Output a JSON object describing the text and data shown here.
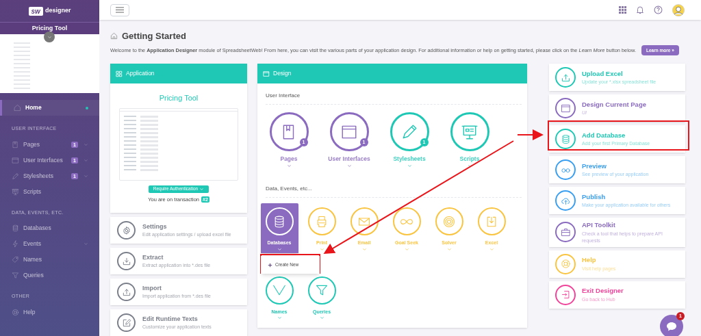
{
  "sidebar": {
    "logo_mark": "sw",
    "logo_text": "designer",
    "app_name": "Pricing Tool",
    "nav": [
      {
        "items": [
          {
            "label": "Home",
            "selected": true,
            "caret": false
          }
        ]
      },
      {
        "heading": "USER INTERFACE",
        "items": [
          {
            "label": "Pages",
            "badge": "1",
            "selected": false,
            "caret": true
          },
          {
            "label": "User Interfaces",
            "badge": "1",
            "selected": false,
            "caret": true
          },
          {
            "label": "Stylesheets",
            "badge": "1",
            "selected": false,
            "caret": true
          },
          {
            "label": "Scripts",
            "selected": false,
            "caret": false
          }
        ]
      },
      {
        "heading": "DATA, EVENTS, ETC.",
        "items": [
          {
            "label": "Databases",
            "selected": false,
            "caret": false
          },
          {
            "label": "Events",
            "selected": false,
            "caret": true
          },
          {
            "label": "Names",
            "selected": false,
            "caret": false
          },
          {
            "label": "Queries",
            "selected": false,
            "caret": false
          }
        ]
      },
      {
        "heading": "OTHER",
        "items": [
          {
            "label": "Help",
            "selected": false,
            "caret": false
          }
        ]
      }
    ]
  },
  "header": {
    "title": "Getting Started",
    "intro": "Welcome to the **Application Designer** module of SpreadsheetWeb! From here, you can visit the various parts of your application design. For additional information or help on getting started, please click on the *Learn More* button below.",
    "learn_more": "Learn more »"
  },
  "application": {
    "heading": "Application",
    "app_name": "Pricing Tool",
    "auth_button": "Require Authentication",
    "transaction_text": "You are on transaction",
    "transaction": "#2",
    "actions": [
      {
        "title": "Settings",
        "subtitle": "Edit application settings / upload excel file"
      },
      {
        "title": "Extract",
        "subtitle": "Extract application into *.des file"
      },
      {
        "title": "Import",
        "subtitle": "Import application from *.des file"
      },
      {
        "title": "Edit Runtime Texts",
        "subtitle": "Customize your application texts"
      }
    ]
  },
  "design": {
    "heading": "Design",
    "ui_heading": "User Interface",
    "ui_items": [
      {
        "label": "Pages",
        "badge": "1",
        "color": "#8a6bbf"
      },
      {
        "label": "User Interfaces",
        "badge": "1",
        "color": "#8a6bbf"
      },
      {
        "label": "Stylesheets",
        "badge": "1",
        "color": "#1fc8b5"
      },
      {
        "label": "Scripts",
        "color": "#1fc8b5"
      }
    ],
    "data_heading": "Data, Events, etc...",
    "data_items": [
      {
        "label": "Databases",
        "color": "#8a6bbf",
        "selected": true,
        "menu": [
          {
            "label": "Create New"
          }
        ]
      },
      {
        "label": "Print",
        "color": "#f9c440",
        "selected": false
      },
      {
        "label": "Email",
        "color": "#f9c440",
        "selected": false
      },
      {
        "label": "Goal Seek",
        "color": "#f9c440",
        "selected": false
      },
      {
        "label": "Solver",
        "color": "#f9c440",
        "selected": false
      },
      {
        "label": "Excel",
        "color": "#f9c440",
        "selected": false
      },
      {
        "label": "Names",
        "color": "#1fc8b5",
        "selected": false
      },
      {
        "label": "Queries",
        "color": "#1fc8b5",
        "selected": false
      }
    ]
  },
  "quick_actions": [
    {
      "title": "Upload Excel",
      "subtitle": "Update your *.xlsx spreadsheet file",
      "color": "#1fc8b5"
    },
    {
      "title": "Design Current Page",
      "subtitle": "UI",
      "color": "#8a6bbf",
      "italic": true
    },
    {
      "title": "Add Database",
      "subtitle": "Add your first Primary Database",
      "color": "#1fc8b5"
    },
    {
      "title": "Preview",
      "subtitle": "See preview of your application",
      "color": "#3a9ff0"
    },
    {
      "title": "Publish",
      "subtitle": "Make your application available for others",
      "color": "#3a9ff0"
    },
    {
      "title": "API Toolkit",
      "subtitle": "Check a tool that helps to prepare API requests",
      "color": "#8a6bbf"
    },
    {
      "title": "Help",
      "subtitle": "Visit help pages",
      "color": "#f9c440"
    },
    {
      "title": "Exit Designer",
      "subtitle": "Go back to Hub",
      "color": "#f0449a"
    }
  ],
  "chat": {
    "badge": "1"
  }
}
